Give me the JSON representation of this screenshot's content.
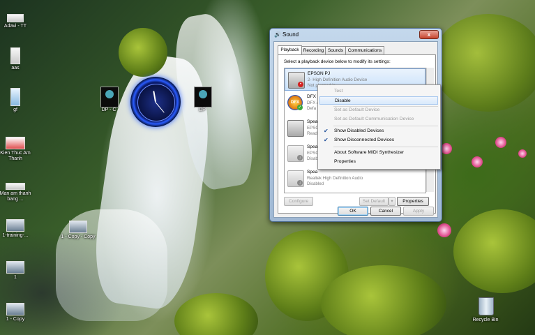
{
  "desktop": {
    "icons": [
      {
        "label": "Adavi - TT"
      },
      {
        "label": "aas"
      },
      {
        "label": "gf"
      },
      {
        "label": "Kien Thuc Am Thanh"
      },
      {
        "label": "Man am thanh bang ..."
      },
      {
        "label": "1-training-..."
      },
      {
        "label": "1"
      },
      {
        "label": "1 - Copy"
      },
      {
        "label": "1 - Copy - Copy"
      },
      {
        "label": "DP - C"
      },
      {
        "label": "DP"
      },
      {
        "label": "Recycle Bin"
      }
    ]
  },
  "dialog": {
    "title": "Sound",
    "close": "x",
    "tabs": [
      "Playback",
      "Recording",
      "Sounds",
      "Communications"
    ],
    "instruction": "Select a playback device below to modify its settings:",
    "devices": [
      {
        "name": "EPSON PJ",
        "line2": "2- High Definition Audio Device",
        "line3": "Not plugged in"
      },
      {
        "name": "DFX S",
        "line2": "DFX A",
        "line3": "Defa"
      },
      {
        "name": "Spea",
        "line2": "EPSO",
        "line3": "Read"
      },
      {
        "name": "Spea",
        "line2": "EPSO",
        "line3": "Disab"
      },
      {
        "name": "Spea",
        "line2": "Realtek High Definition Audio",
        "line3": "Disabled"
      }
    ],
    "buttons": {
      "configure": "Configure",
      "set_default": "Set Default",
      "properties": "Properties",
      "ok": "OK",
      "cancel": "Cancel",
      "apply": "Apply"
    }
  },
  "context_menu": {
    "items": [
      {
        "label": "Test",
        "state": "disabled"
      },
      {
        "label": "Disable",
        "state": "highlighted"
      },
      {
        "label": "Set as Default Device",
        "state": "disabled"
      },
      {
        "label": "Set as Default Communication Device",
        "state": "disabled"
      },
      {
        "label": "Show Disabled Devices",
        "checked": true
      },
      {
        "label": "Show Disconnected Devices",
        "checked": true
      },
      {
        "label": "About Software MIDI Synthesizer"
      },
      {
        "label": "Properties"
      }
    ]
  }
}
